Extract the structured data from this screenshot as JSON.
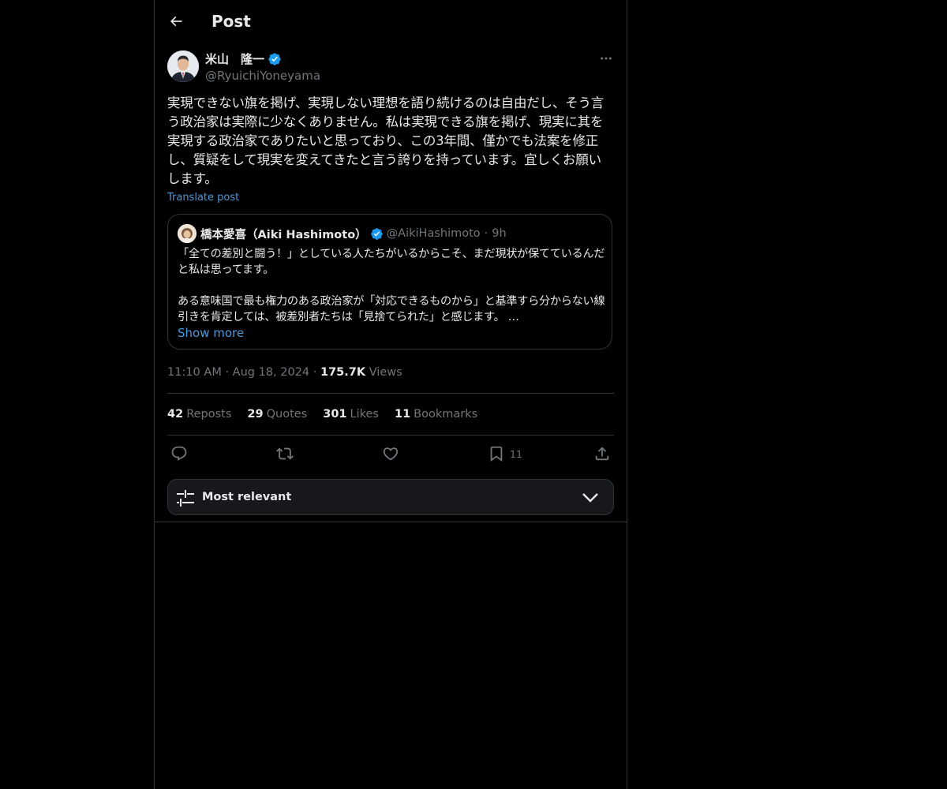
{
  "header": {
    "title": "Post",
    "back_icon": "arrow-left-icon"
  },
  "post": {
    "author_name": "米山　隆一",
    "author_handle": "@RyuichiYoneyama",
    "verified_icon": "verified-badge-icon",
    "more_icon": "more-horizontal-icon",
    "text": "実現できない旗を掲げ、実現しない理想を語り続けるのは自由だし、そう言う政治家は実際に少なくありません。私は実現できる旗を掲げ、現実に其を実現する政治家でありたいと思っており、この3年間、僅かでも法案を修正し、質疑をして現実を変えてきたと言う誇りを持っています。宜しくお願いします。",
    "translate_label": "Translate post",
    "time": "11:10 AM",
    "date": "Aug 18, 2024",
    "views_count": "175.7K",
    "views_label": "Views",
    "separator": "·"
  },
  "quote": {
    "author_name": "橋本愛喜（Aiki Hashimoto）",
    "author_handle": "@AikiHashimoto",
    "separator": "·",
    "time": "9h",
    "text": "「全ての差別と闘う！」としている人たちがいるからこそ、まだ現状が保てているんだと私は思ってます。\n\nある意味国で最も権力のある政治家が「対応できるものから」と基準すら分からない線引きを肯定しては、被差別者たちは「見捨てられた」と感じます。 …",
    "show_more_label": "Show more"
  },
  "stats": [
    {
      "count": "42",
      "label": "Reposts"
    },
    {
      "count": "29",
      "label": "Quotes"
    },
    {
      "count": "301",
      "label": "Likes"
    },
    {
      "count": "11",
      "label": "Bookmarks"
    }
  ],
  "actions": {
    "reply_icon": "reply-icon",
    "repost_icon": "repost-icon",
    "like_icon": "heart-icon",
    "bookmark_icon": "bookmark-icon",
    "bookmark_count": "11",
    "share_icon": "share-icon"
  },
  "sort": {
    "label": "Most relevant",
    "icon": "sliders-icon",
    "chevron": "chevron-down-icon"
  },
  "colors": {
    "background": "#000000",
    "text": "#e7e9ea",
    "secondary": "#71767b",
    "link": "#4f98d8",
    "verified": "#1d9bf0",
    "border": "#2f3336"
  }
}
